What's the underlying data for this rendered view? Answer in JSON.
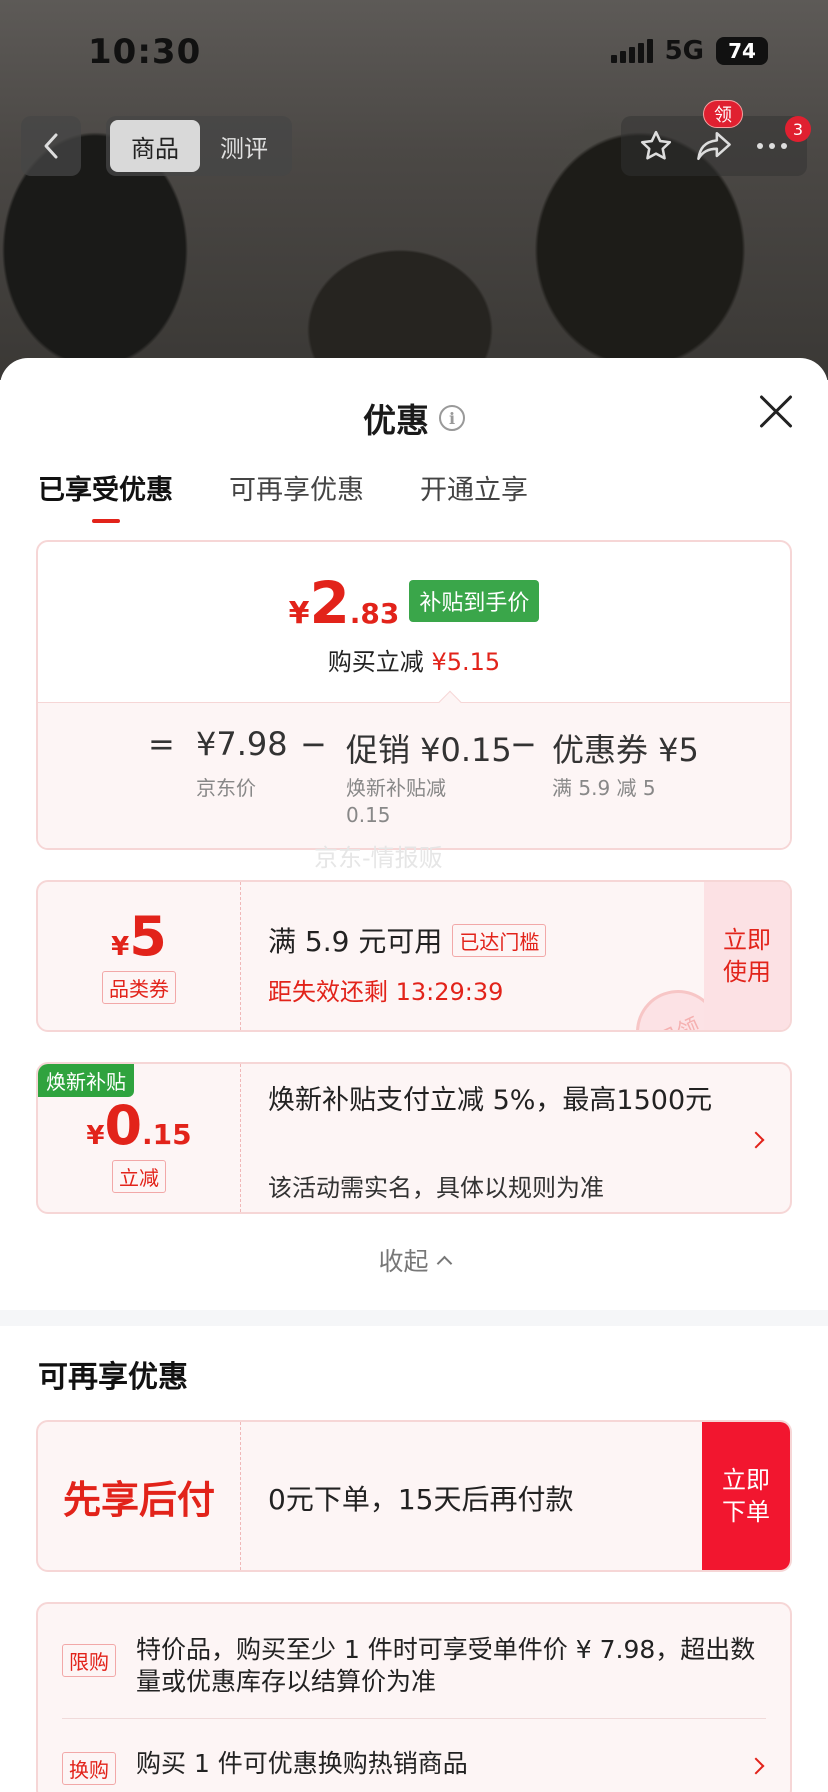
{
  "status_bar": {
    "time": "10:30",
    "network": "5G",
    "battery": "74"
  },
  "nav": {
    "tabs": [
      {
        "label": "商品"
      },
      {
        "label": "测评"
      }
    ],
    "badge_ling": "领",
    "badge_count": "3"
  },
  "sheet": {
    "title": "优惠",
    "tabs": [
      {
        "label": "已享受优惠"
      },
      {
        "label": "可再享优惠"
      },
      {
        "label": "开通立享"
      }
    ],
    "summary": {
      "currency": "¥",
      "price_int": "2",
      "price_dec": ".83",
      "price_tag": "补贴到手价",
      "reduce_label": "购买立减",
      "reduce_value": "¥5.15",
      "eq": "=",
      "jd_price": "¥7.98",
      "jd_price_label": "京东价",
      "minus1": "−",
      "promo": "促销 ¥0.15",
      "promo_label": "焕新补贴减 0.15",
      "minus2": "−",
      "coupon": "优惠券 ¥5",
      "coupon_label": "满 5.9 减 5"
    },
    "watermark": "京东-情报贩",
    "coupon_card": {
      "currency": "¥",
      "amount": "5",
      "type": "品类券",
      "condition": "满 5.9 元可用",
      "threshold_tag": "已达门槛",
      "expire": "距失效还剩 13:29:39",
      "button": "立即使用",
      "stamp": "已领"
    },
    "subsidy_card": {
      "corner_tag": "焕新补贴",
      "currency": "¥",
      "amount_int": "0",
      "amount_dec": ".15",
      "type": "立减",
      "desc": "焕新补贴支付立减 5%，最高1500元",
      "note": "该活动需实名，具体以规则为准"
    },
    "collapse_label": "收起",
    "section2_title": "可再享优惠",
    "bnpl": {
      "title": "先享后付",
      "desc": "0元下单，15天后再付款",
      "button": "立即下单"
    },
    "rules": [
      {
        "tag": "限购",
        "text": "特价品，购买至少 1 件时可享受单件价 ¥ 7.98，超出数量或优惠库存以结算价为准"
      },
      {
        "tag": "换购",
        "text": "购买 1 件可优惠换购热销商品"
      }
    ]
  },
  "colors": {
    "accent_red": "#e2231a",
    "subsidy_green": "#3aa64a",
    "card_bg": "#fdf5f5"
  }
}
